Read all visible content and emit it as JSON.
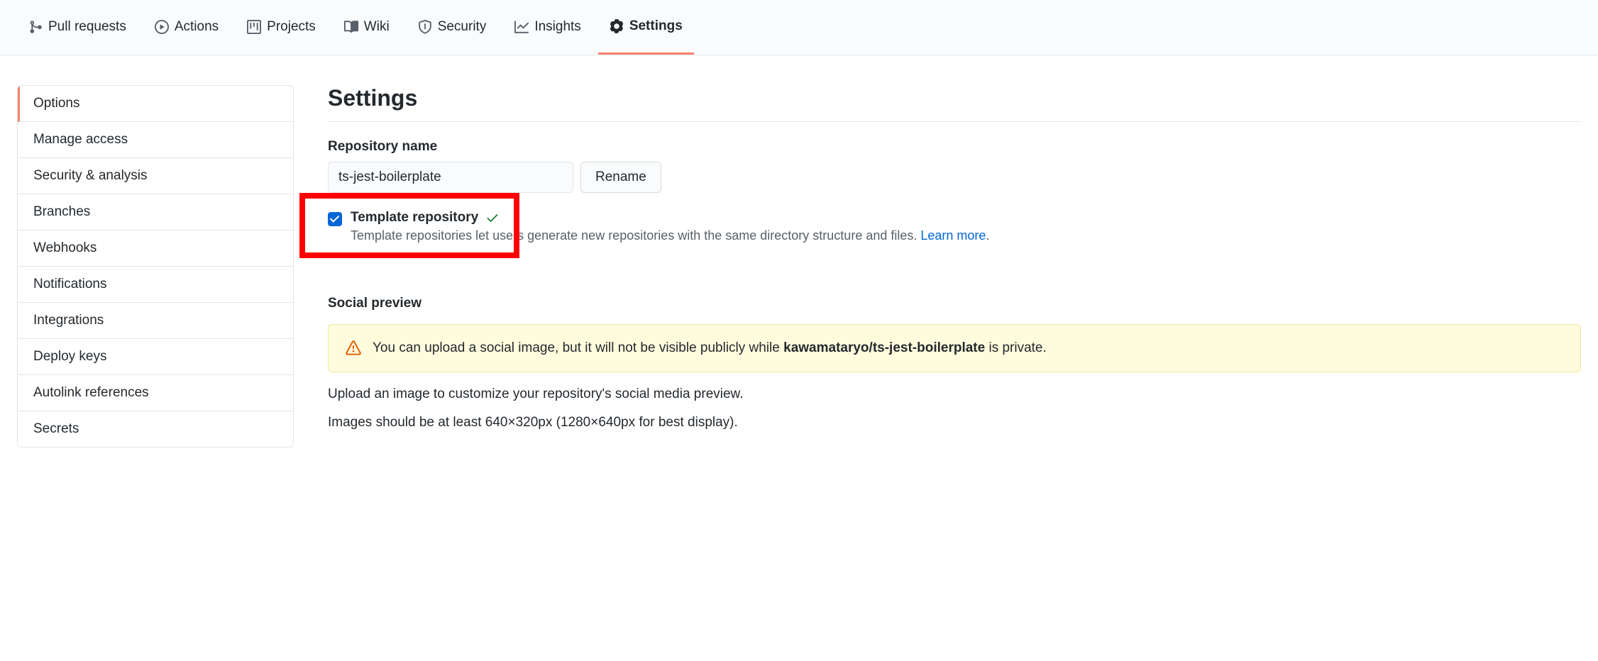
{
  "topnav": {
    "items": [
      {
        "label": "Pull requests",
        "name": "tab-pull-requests"
      },
      {
        "label": "Actions",
        "name": "tab-actions"
      },
      {
        "label": "Projects",
        "name": "tab-projects"
      },
      {
        "label": "Wiki",
        "name": "tab-wiki"
      },
      {
        "label": "Security",
        "name": "tab-security"
      },
      {
        "label": "Insights",
        "name": "tab-insights"
      },
      {
        "label": "Settings",
        "name": "tab-settings",
        "selected": true
      }
    ]
  },
  "sidebar": {
    "items": [
      {
        "label": "Options",
        "selected": true
      },
      {
        "label": "Manage access"
      },
      {
        "label": "Security & analysis"
      },
      {
        "label": "Branches"
      },
      {
        "label": "Webhooks"
      },
      {
        "label": "Notifications"
      },
      {
        "label": "Integrations"
      },
      {
        "label": "Deploy keys"
      },
      {
        "label": "Autolink references"
      },
      {
        "label": "Secrets"
      }
    ]
  },
  "main": {
    "page_title": "Settings",
    "repo_name_label": "Repository name",
    "repo_name_value": "ts-jest-boilerplate",
    "rename_button": "Rename",
    "template": {
      "label": "Template repository",
      "checked": true,
      "description_prefix": "Template repositories let users generate new repositories with the same directory structure and files. ",
      "learn_more": "Learn more",
      "description_suffix": "."
    },
    "social_preview": {
      "heading": "Social preview",
      "warn_prefix": "You can upload a social image, but it will not be visible publicly while ",
      "warn_repo": "kawamataryo/ts-jest-boilerplate",
      "warn_suffix": " is private.",
      "line1": "Upload an image to customize your repository's social media preview.",
      "line2": "Images should be at least 640×320px (1280×640px for best display)."
    }
  }
}
